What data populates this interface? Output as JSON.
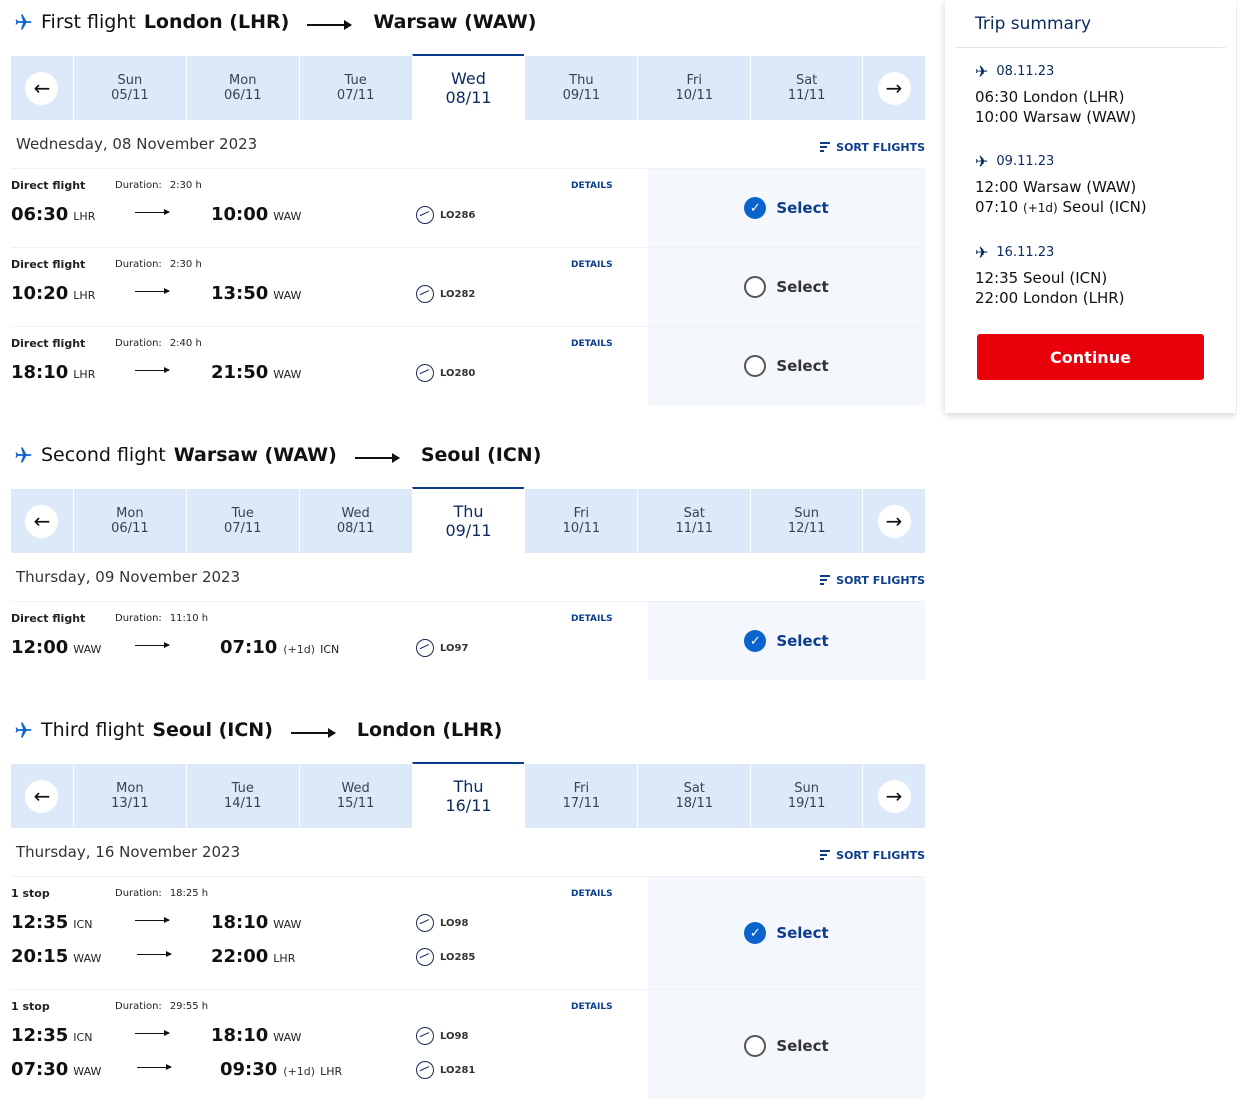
{
  "sections": [
    {
      "label": "First flight",
      "from": "London (LHR)",
      "to": "Warsaw (WAW)",
      "dates": [
        {
          "dow": "Sun",
          "date": "05/11"
        },
        {
          "dow": "Mon",
          "date": "06/11"
        },
        {
          "dow": "Tue",
          "date": "07/11"
        },
        {
          "dow": "Wed",
          "date": "08/11"
        },
        {
          "dow": "Thu",
          "date": "09/11"
        },
        {
          "dow": "Fri",
          "date": "10/11"
        },
        {
          "dow": "Sat",
          "date": "11/11"
        }
      ],
      "active_index": 3,
      "day_label": "Wednesday, 08 November 2023",
      "sort_label": "SORT FLIGHTS",
      "flights": [
        {
          "type": "Direct flight",
          "duration_label": "Duration:",
          "duration": "2:30 h",
          "details": "DETAILS",
          "segments": [
            {
              "dep": "06:30",
              "dep_ap": "LHR",
              "arr": "10:00",
              "arr_ap": "WAW",
              "plus": "",
              "code": "LO286"
            }
          ],
          "select": "Select",
          "selected": true
        },
        {
          "type": "Direct flight",
          "duration_label": "Duration:",
          "duration": "2:30 h",
          "details": "DETAILS",
          "segments": [
            {
              "dep": "10:20",
              "dep_ap": "LHR",
              "arr": "13:50",
              "arr_ap": "WAW",
              "plus": "",
              "code": "LO282"
            }
          ],
          "select": "Select",
          "selected": false
        },
        {
          "type": "Direct flight",
          "duration_label": "Duration:",
          "duration": "2:40 h",
          "details": "DETAILS",
          "segments": [
            {
              "dep": "18:10",
              "dep_ap": "LHR",
              "arr": "21:50",
              "arr_ap": "WAW",
              "plus": "",
              "code": "LO280"
            }
          ],
          "select": "Select",
          "selected": false
        }
      ]
    },
    {
      "label": "Second flight",
      "from": "Warsaw (WAW)",
      "to": "Seoul (ICN)",
      "dates": [
        {
          "dow": "Mon",
          "date": "06/11"
        },
        {
          "dow": "Tue",
          "date": "07/11"
        },
        {
          "dow": "Wed",
          "date": "08/11"
        },
        {
          "dow": "Thu",
          "date": "09/11"
        },
        {
          "dow": "Fri",
          "date": "10/11"
        },
        {
          "dow": "Sat",
          "date": "11/11"
        },
        {
          "dow": "Sun",
          "date": "12/11"
        }
      ],
      "active_index": 3,
      "day_label": "Thursday, 09 November 2023",
      "sort_label": "SORT FLIGHTS",
      "flights": [
        {
          "type": "Direct flight",
          "duration_label": "Duration:",
          "duration": "11:10 h",
          "details": "DETAILS",
          "segments": [
            {
              "dep": "12:00",
              "dep_ap": "WAW",
              "arr": "07:10",
              "arr_ap": "ICN",
              "plus": "(+1d)",
              "code": "LO97"
            }
          ],
          "select": "Select",
          "selected": true
        }
      ]
    },
    {
      "label": "Third flight",
      "from": "Seoul (ICN)",
      "to": "London (LHR)",
      "dates": [
        {
          "dow": "Mon",
          "date": "13/11"
        },
        {
          "dow": "Tue",
          "date": "14/11"
        },
        {
          "dow": "Wed",
          "date": "15/11"
        },
        {
          "dow": "Thu",
          "date": "16/11"
        },
        {
          "dow": "Fri",
          "date": "17/11"
        },
        {
          "dow": "Sat",
          "date": "18/11"
        },
        {
          "dow": "Sun",
          "date": "19/11"
        }
      ],
      "active_index": 3,
      "day_label": "Thursday, 16 November 2023",
      "sort_label": "SORT FLIGHTS",
      "flights": [
        {
          "type": "1 stop",
          "duration_label": "Duration:",
          "duration": "18:25 h",
          "details": "DETAILS",
          "segments": [
            {
              "dep": "12:35",
              "dep_ap": "ICN",
              "arr": "18:10",
              "arr_ap": "WAW",
              "plus": "",
              "code": "LO98"
            },
            {
              "dep": "20:15",
              "dep_ap": "WAW",
              "arr": "22:00",
              "arr_ap": "LHR",
              "plus": "",
              "code": "LO285"
            }
          ],
          "select": "Select",
          "selected": true
        },
        {
          "type": "1 stop",
          "duration_label": "Duration:",
          "duration": "29:55 h",
          "details": "DETAILS",
          "segments": [
            {
              "dep": "12:35",
              "dep_ap": "ICN",
              "arr": "18:10",
              "arr_ap": "WAW",
              "plus": "",
              "code": "LO98"
            },
            {
              "dep": "07:30",
              "dep_ap": "WAW",
              "arr": "09:30",
              "arr_ap": "LHR",
              "plus": "(+1d)",
              "code": "LO281"
            }
          ],
          "select": "Select",
          "selected": false
        }
      ]
    }
  ],
  "summary": {
    "title": "Trip summary",
    "legs": [
      {
        "date": "08.11.23",
        "line1": "06:30 London (LHR)",
        "line2_time": "10:00",
        "line2_plus": "",
        "line2_place": "Warsaw (WAW)"
      },
      {
        "date": "09.11.23",
        "line1": "12:00 Warsaw (WAW)",
        "line2_time": "07:10",
        "line2_plus": "(+1d)",
        "line2_place": "Seoul (ICN)"
      },
      {
        "date": "16.11.23",
        "line1": "12:35 Seoul (ICN)",
        "line2_time": "22:00",
        "line2_plus": "",
        "line2_place": "London (LHR)"
      }
    ],
    "continue_label": "Continue"
  },
  "colors": {
    "accent": "#0b3d8c",
    "brand_blue": "#0b63ce",
    "continue_red": "#e8000a",
    "datebar": "#dce9f9"
  },
  "icons": {
    "plane": "airplane-icon",
    "prev": "arrow-left-icon",
    "next": "arrow-right-icon",
    "sort": "sort-icon",
    "carrier": "lot-logo-icon",
    "check": "check-circle-icon"
  }
}
